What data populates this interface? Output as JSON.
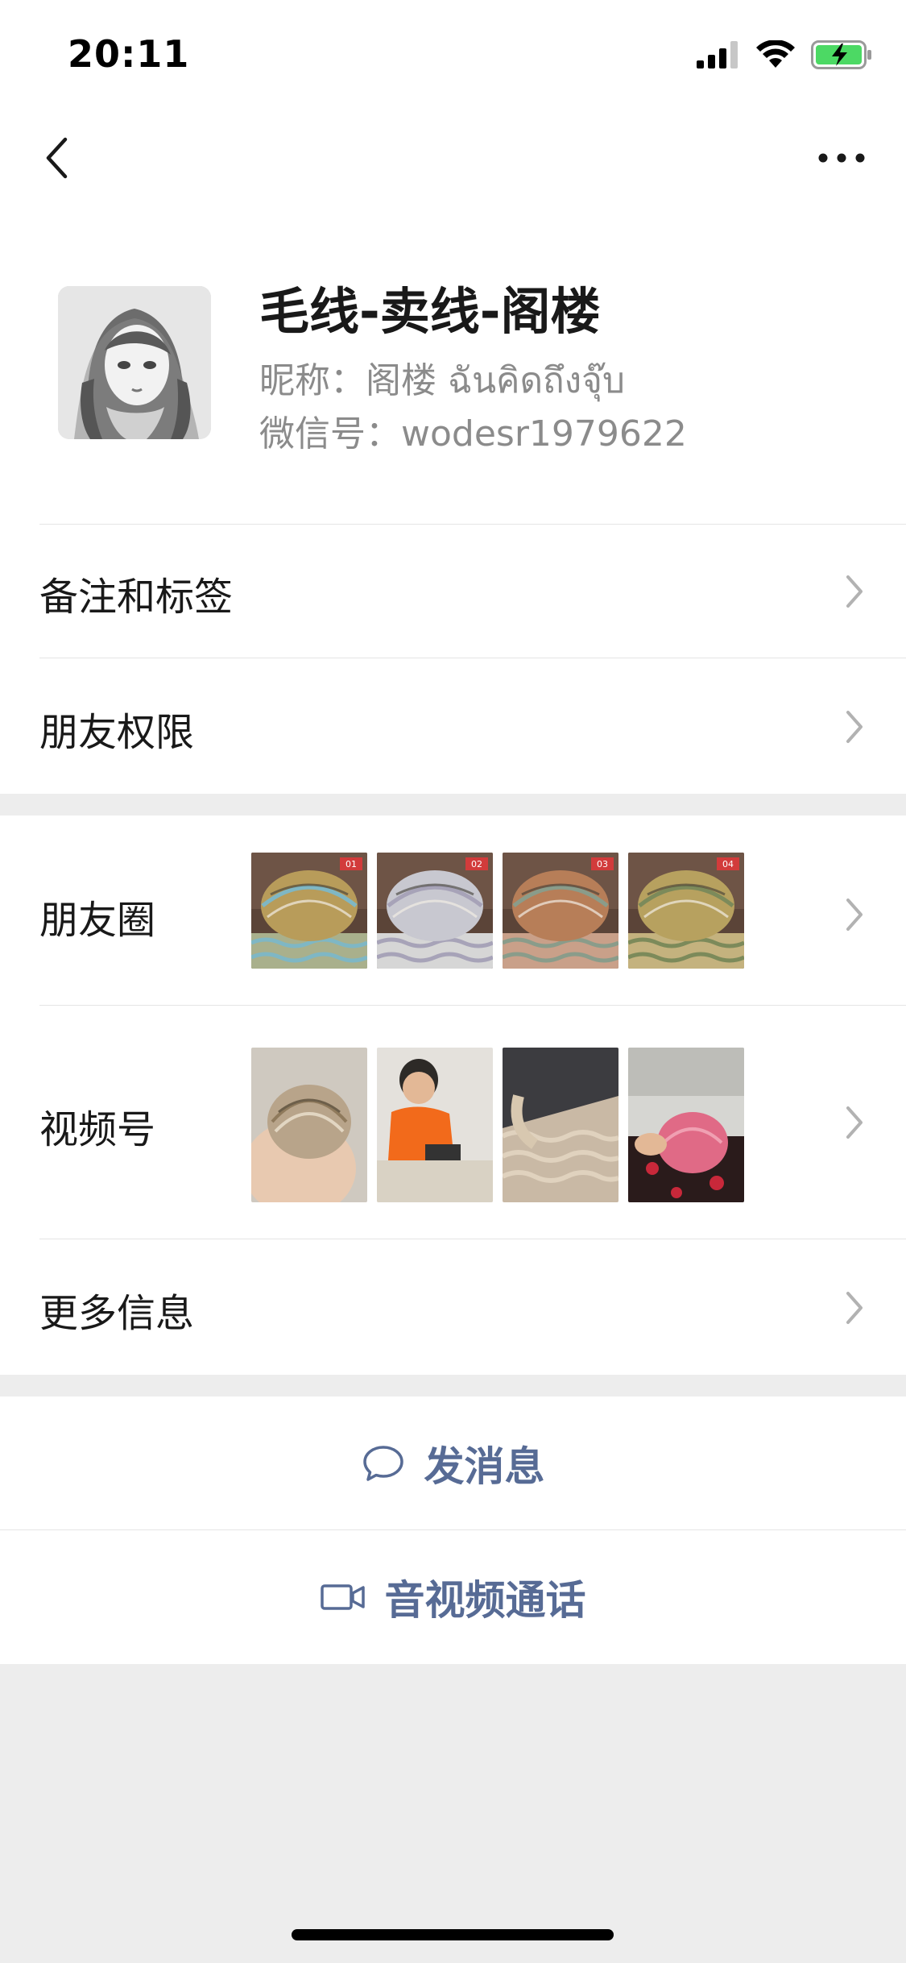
{
  "status_bar": {
    "time": "20:11"
  },
  "profile": {
    "display_name": "毛线-卖线-阁楼",
    "nickname_label": "昵称：",
    "nickname": "阁楼 ฉันคิดถึงจุ๊บ",
    "wechat_id_label": "微信号：",
    "wechat_id": "wodesr1979622"
  },
  "rows": {
    "remarks_tags": "备注和标签",
    "friend_permissions": "朋友权限",
    "moments": "朋友圈",
    "channels": "视频号",
    "more_info": "更多信息"
  },
  "moments_thumbs": [
    {
      "tag": "01",
      "yarn": "#b89c5a",
      "stripe": "#7fb7c4",
      "base": "#a9b08c"
    },
    {
      "tag": "02",
      "yarn": "#c8c8d0",
      "stripe": "#a7a3b8",
      "base": "#d6d6d6"
    },
    {
      "tag": "03",
      "yarn": "#b77e58",
      "stripe": "#8a9c8a",
      "base": "#c9a089"
    },
    {
      "tag": "04",
      "yarn": "#b7a15f",
      "stripe": "#7c8a5a",
      "base": "#c4b27e"
    }
  ],
  "actions": {
    "send_message": "发消息",
    "video_call": "音视频通话"
  },
  "colors": {
    "link_blue": "#576b95",
    "secondary_text": "#8b8b8b",
    "background": "#ededed",
    "battery_green": "#4cd964"
  },
  "icons": {
    "back": "chevron-left-icon",
    "more": "more-dots-icon",
    "row_chevron": "chevron-right-icon",
    "message": "chat-bubble-icon",
    "video": "video-camera-icon"
  }
}
